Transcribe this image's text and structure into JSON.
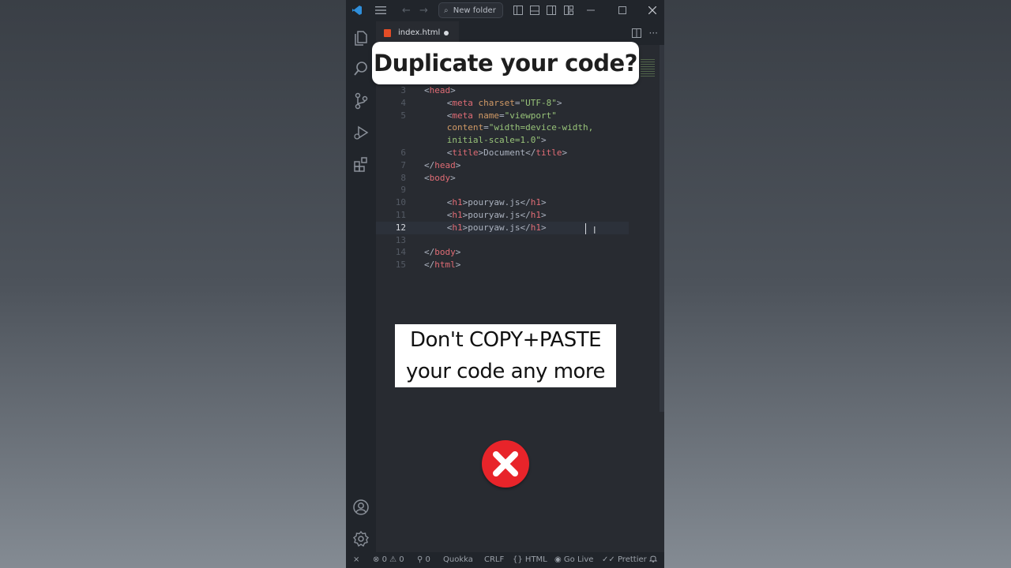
{
  "titlebar": {
    "search_label": "New folder",
    "menu_icon": "hamburger-menu-icon"
  },
  "tab": {
    "filename": "index.html",
    "modified": true
  },
  "code": {
    "lines": [
      {
        "n": "3",
        "segments": [
          [
            "br",
            "<"
          ],
          [
            "tag",
            "head"
          ],
          [
            "br",
            ">"
          ]
        ],
        "indent": 0
      },
      {
        "n": "4",
        "segments": [
          [
            "br",
            "<"
          ],
          [
            "tag",
            "meta "
          ],
          [
            "attr",
            "charset"
          ],
          [
            "br",
            "="
          ],
          [
            "str",
            "\"UTF-8\""
          ],
          [
            "br",
            ">"
          ]
        ],
        "indent": 1
      },
      {
        "n": "5",
        "segments": [
          [
            "br",
            "<"
          ],
          [
            "tag",
            "meta "
          ],
          [
            "attr",
            "name"
          ],
          [
            "br",
            "="
          ],
          [
            "str",
            "\"viewport\""
          ]
        ],
        "indent": 1
      },
      {
        "n": "",
        "segments": [
          [
            "attr",
            "content"
          ],
          [
            "br",
            "="
          ],
          [
            "str",
            "\"width=device-width,"
          ]
        ],
        "indent": 1
      },
      {
        "n": "",
        "segments": [
          [
            "str",
            "initial-scale=1.0\""
          ],
          [
            "br",
            ">"
          ]
        ],
        "indent": 1
      },
      {
        "n": "6",
        "segments": [
          [
            "br",
            "<"
          ],
          [
            "tag",
            "title"
          ],
          [
            "br",
            ">"
          ],
          [
            "txt",
            "Document"
          ],
          [
            "br",
            "</"
          ],
          [
            "tag",
            "title"
          ],
          [
            "br",
            ">"
          ]
        ],
        "indent": 1
      },
      {
        "n": "7",
        "segments": [
          [
            "br",
            "</"
          ],
          [
            "tag",
            "head"
          ],
          [
            "br",
            ">"
          ]
        ],
        "indent": 0
      },
      {
        "n": "8",
        "segments": [
          [
            "br",
            "<"
          ],
          [
            "tag",
            "body"
          ],
          [
            "br",
            ">"
          ]
        ],
        "indent": 0
      },
      {
        "n": "9",
        "segments": [],
        "indent": 0
      },
      {
        "n": "10",
        "segments": [
          [
            "br",
            "<"
          ],
          [
            "tag",
            "h1"
          ],
          [
            "br",
            ">"
          ],
          [
            "txt",
            "pouryaw.js"
          ],
          [
            "br",
            "</"
          ],
          [
            "tag",
            "h1"
          ],
          [
            "br",
            ">"
          ]
        ],
        "indent": 1
      },
      {
        "n": "11",
        "segments": [
          [
            "br",
            "<"
          ],
          [
            "tag",
            "h1"
          ],
          [
            "br",
            ">"
          ],
          [
            "txt",
            "pouryaw.js"
          ],
          [
            "br",
            "</"
          ],
          [
            "tag",
            "h1"
          ],
          [
            "br",
            ">"
          ]
        ],
        "indent": 1
      },
      {
        "n": "12",
        "segments": [
          [
            "br",
            "<"
          ],
          [
            "tag",
            "h1"
          ],
          [
            "br",
            ">"
          ],
          [
            "txt",
            "pouryaw.js"
          ],
          [
            "br",
            "</"
          ],
          [
            "tag",
            "h1"
          ],
          [
            "br",
            ">"
          ]
        ],
        "indent": 1,
        "active": true
      },
      {
        "n": "13",
        "segments": [],
        "indent": 0
      },
      {
        "n": "14",
        "segments": [
          [
            "br",
            "</"
          ],
          [
            "tag",
            "body"
          ],
          [
            "br",
            ">"
          ]
        ],
        "indent": 0
      },
      {
        "n": "15",
        "segments": [
          [
            "br",
            "</"
          ],
          [
            "tag",
            "html"
          ],
          [
            "br",
            ">"
          ]
        ],
        "indent": 0
      }
    ]
  },
  "statusbar": {
    "errors": "0",
    "warnings": "0",
    "ports": "0",
    "quokka": "Quokka",
    "eol": "CRLF",
    "language": "HTML",
    "golive": "Go Live",
    "prettier": "Prettier"
  },
  "overlay": {
    "title": "Duplicate your code?",
    "caption_line1": "Don't COPY+PASTE",
    "caption_line2": "your code any more"
  }
}
